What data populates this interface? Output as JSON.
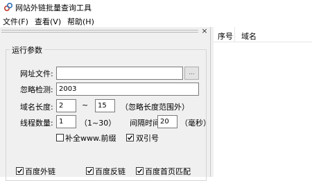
{
  "window": {
    "title": "网站外链批量查询工具"
  },
  "menu": {
    "items": [
      "文件(F)",
      "查看(V)",
      "帮助(H)"
    ]
  },
  "panel": {
    "close_glyph": "×",
    "group_title": "运行参数",
    "url_file": {
      "label": "网址文件:",
      "value": "",
      "browse_label": "..."
    },
    "ignore": {
      "label": "忽略检测:",
      "value": "2003"
    },
    "domain_length": {
      "label": "域名长度:",
      "min": "2",
      "sep": "~",
      "max": "15",
      "hint": "（忽略长度范围外）"
    },
    "threads": {
      "label": "线程数量:",
      "value": "1",
      "hint": "（1~30）"
    },
    "interval": {
      "label": "间隔时间:",
      "value": "20",
      "unit": "（毫秒）"
    },
    "options": [
      {
        "label": "补全www.前缀",
        "checked": false
      },
      {
        "label": "双引号",
        "checked": true
      }
    ],
    "engines": [
      {
        "label": "百度外链",
        "checked": true
      },
      {
        "label": "百度反链",
        "checked": true
      },
      {
        "label": "百度首页匹配",
        "checked": true
      }
    ]
  },
  "list": {
    "columns": [
      "序号",
      "域名"
    ]
  },
  "colors": {
    "panel_bg": "#f0f0f0",
    "field_border": "#7a7a7a"
  }
}
